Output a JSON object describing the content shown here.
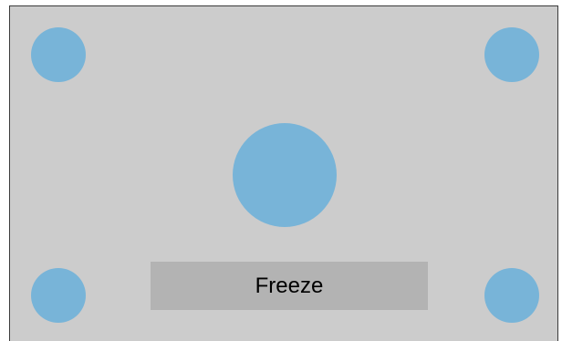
{
  "app": {
    "freeze_button_label": "Freeze"
  },
  "targets": [
    {
      "id": "top-left",
      "size": "small"
    },
    {
      "id": "top-right",
      "size": "small"
    },
    {
      "id": "center",
      "size": "large"
    },
    {
      "id": "bottom-left",
      "size": "small"
    },
    {
      "id": "bottom-right",
      "size": "small"
    }
  ],
  "colors": {
    "background": "#cccccc",
    "target": "#78b4d8",
    "button": "#b3b3b3"
  }
}
